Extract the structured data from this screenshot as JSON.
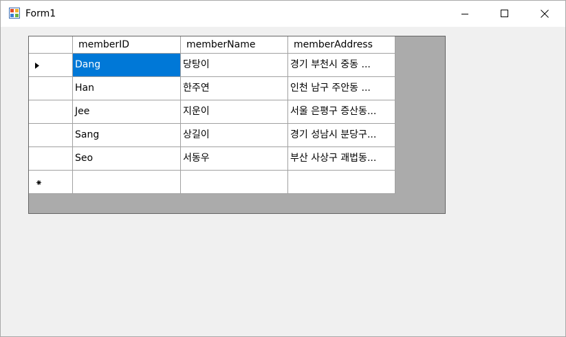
{
  "window": {
    "title": "Form1"
  },
  "grid": {
    "columns": [
      "memberID",
      "memberName",
      "memberAddress"
    ],
    "rows": [
      {
        "id": "Dang",
        "name": "당탕이",
        "address": "경기 부천시 중동   ..."
      },
      {
        "id": "Han",
        "name": "한주연",
        "address": "인천 남구 주안동   ..."
      },
      {
        "id": "Jee",
        "name": "지운이",
        "address": "서울 은평구 증산동..."
      },
      {
        "id": "Sang",
        "name": "상길이",
        "address": "경기 성남시 분당구..."
      },
      {
        "id": "Seo",
        "name": "서동우",
        "address": "부산 사상구 괘법동..."
      }
    ],
    "current_row_indicator": "current-row-arrow-icon",
    "new_row_indicator": "new-row-asterisk-icon",
    "selection_color": "#0078d7"
  }
}
